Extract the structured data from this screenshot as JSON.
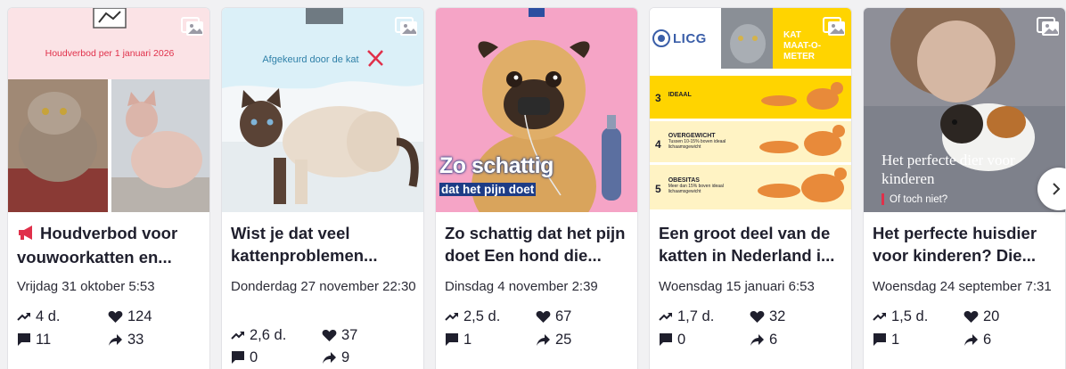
{
  "cards": [
    {
      "image": {
        "banner": "Houdverbod per 1 januari 2026"
      },
      "title_icon": "megaphone-icon",
      "title": "Houdverbod voor vouwoorkatten en...",
      "date": "Vrijdag 31 oktober 5:53",
      "stats": {
        "trend": "4 d.",
        "likes": "124",
        "comments": "11",
        "shares": "33"
      }
    },
    {
      "image": {
        "banner": "Afgekeurd door de kat"
      },
      "title": "Wist je dat veel kattenproblemen...",
      "date": "Donderdag 27 november 22:30",
      "stats": {
        "trend": "2,6 d.",
        "likes": "37",
        "comments": "0",
        "shares": "9"
      }
    },
    {
      "image": {
        "headline": "Zo schattig",
        "subline": "dat het pijn doet"
      },
      "title": "Zo schattig dat het pijn doet Een hond die...",
      "date": "Dinsdag 4 november 2:39",
      "stats": {
        "trend": "2,5 d.",
        "likes": "67",
        "comments": "1",
        "shares": "25"
      }
    },
    {
      "image": {
        "logo": "LICG",
        "badge": "KAT MAAT-O-METER",
        "rows": [
          {
            "num": "3",
            "label": "IDEAAL",
            "desc": ""
          },
          {
            "num": "4",
            "label": "OVERGEWICHT",
            "desc": "Tussen 10-15% boven ideaal lichaamsgewicht"
          },
          {
            "num": "5",
            "label": "OBESITAS",
            "desc": "Meer dan 15% boven ideaal lichaamsgewicht"
          }
        ]
      },
      "title": "Een groot deel van de katten in Nederland i...",
      "date": "Woensdag 15 januari 6:53",
      "stats": {
        "trend": "1,7 d.",
        "likes": "32",
        "comments": "0",
        "shares": "6"
      }
    },
    {
      "image": {
        "headline": "Het perfecte dier voor kinderen",
        "subline": "Of toch niet?"
      },
      "title": "Het perfecte huisdier voor kinderen? Die...",
      "date": "Woensdag 24 september 7:31",
      "stats": {
        "trend": "1,5 d.",
        "likes": "20",
        "comments": "1",
        "shares": "6"
      }
    }
  ],
  "colors": {
    "accent_red": "#e0304a",
    "banner_pink": "#fbe3e6",
    "maat_yellow": "#ffd400",
    "text": "#1f1f2d"
  },
  "icons": {
    "trend": "trending-up-icon",
    "likes": "heart-icon",
    "comments": "comment-icon",
    "shares": "share-arrow-icon",
    "gallery": "image-gallery-icon",
    "next": "chevron-right-icon"
  }
}
